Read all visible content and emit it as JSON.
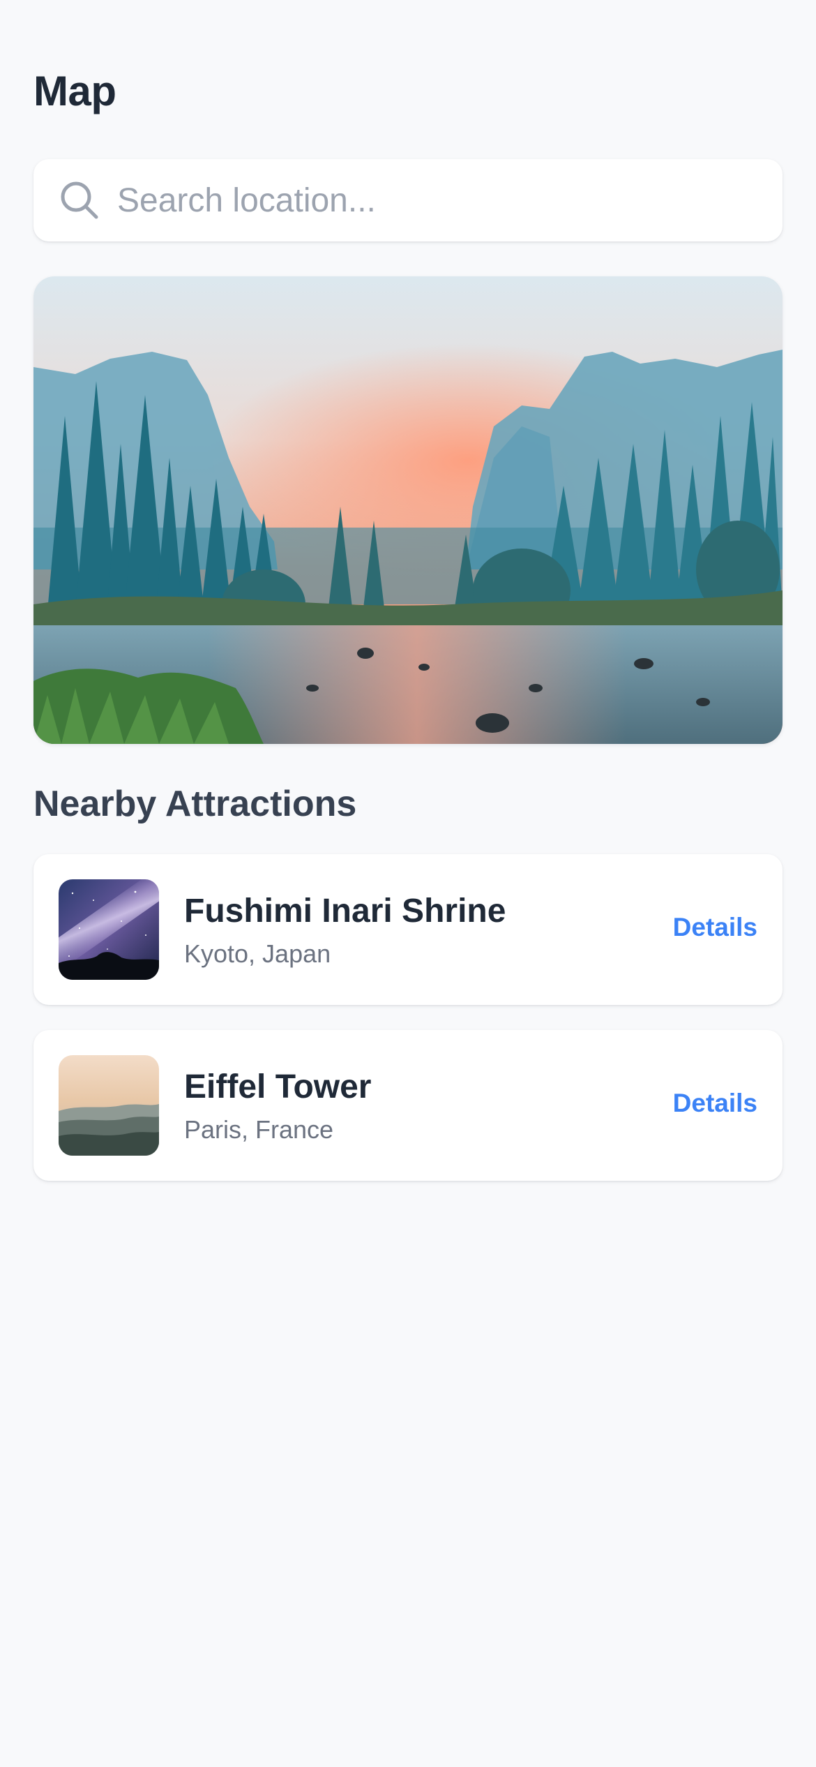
{
  "header": {
    "title": "Map"
  },
  "search": {
    "placeholder": "Search location...",
    "value": "",
    "icon": "search-icon"
  },
  "hero": {
    "icon": "landscape-photo"
  },
  "attractions": {
    "section_title": "Nearby Attractions",
    "items": [
      {
        "name": "Fushimi Inari Shrine",
        "location": "Kyoto, Japan",
        "action_label": "Details"
      },
      {
        "name": "Eiffel Tower",
        "location": "Paris, France",
        "action_label": "Details"
      }
    ]
  },
  "colors": {
    "background": "#f8f9fb",
    "accent": "#3b82f6",
    "title": "#1f2937",
    "muted": "#6b7280"
  }
}
